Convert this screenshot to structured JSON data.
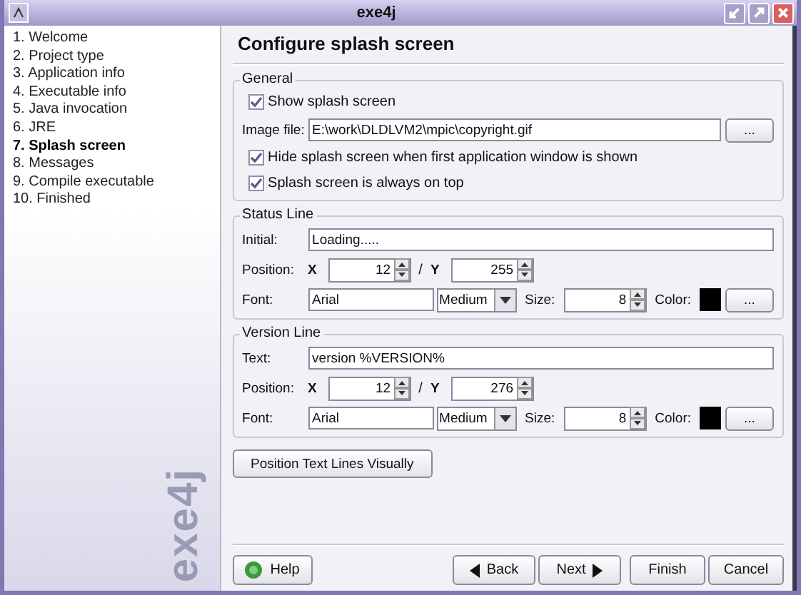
{
  "window": {
    "title": "exe4j"
  },
  "steps": [
    {
      "label": "1. Welcome",
      "selected": false
    },
    {
      "label": "2. Project type",
      "selected": false
    },
    {
      "label": "3. Application info",
      "selected": false
    },
    {
      "label": "4. Executable info",
      "selected": false
    },
    {
      "label": "5. Java invocation",
      "selected": false
    },
    {
      "label": "6. JRE",
      "selected": false
    },
    {
      "label": "7. Splash screen",
      "selected": true
    },
    {
      "label": "8. Messages",
      "selected": false
    },
    {
      "label": "9. Compile executable",
      "selected": false
    },
    {
      "label": "10. Finished",
      "selected": false
    }
  ],
  "logo": "exe4j",
  "page_title": "Configure splash screen",
  "general": {
    "title": "General",
    "show_splash": {
      "label": "Show splash screen",
      "checked": true
    },
    "image_file": {
      "label": "Image file:",
      "value": "E:\\work\\DLDLVM2\\mpic\\copyright.gif",
      "browse": "..."
    },
    "hide_splash": {
      "label": "Hide splash screen when first application window is shown",
      "checked": true
    },
    "always_on_top": {
      "label": "Splash screen is always on top",
      "checked": true
    }
  },
  "lines": [
    {
      "title": "Status Line",
      "text_label": "Initial:",
      "text_value": "Loading.....",
      "position_label": "Position:",
      "x_label": "X",
      "x_value": "12",
      "separator": "/",
      "y_label": "Y",
      "y_value": "255",
      "font_label": "Font:",
      "font_value": "Arial",
      "weight": "Medium",
      "size_label": "Size:",
      "size_value": "8",
      "color_label": "Color:",
      "color_button": "..."
    },
    {
      "title": "Version Line",
      "text_label": "Text:",
      "text_value": "version %VERSION%",
      "position_label": "Position:",
      "x_label": "X",
      "x_value": "12",
      "separator": "/",
      "y_label": "Y",
      "y_value": "276",
      "font_label": "Font:",
      "font_value": "Arial",
      "weight": "Medium",
      "size_label": "Size:",
      "size_value": "8",
      "color_label": "Color:",
      "color_button": "..."
    }
  ],
  "position_button": "Position Text Lines Visually",
  "footer": [
    {
      "label": "Help",
      "kind": "help"
    },
    {
      "label": "Back",
      "kind": "back"
    },
    {
      "label": "Next",
      "kind": "next"
    },
    {
      "label": "Finish",
      "kind": "plain"
    },
    {
      "label": "Cancel",
      "kind": "plain"
    }
  ]
}
